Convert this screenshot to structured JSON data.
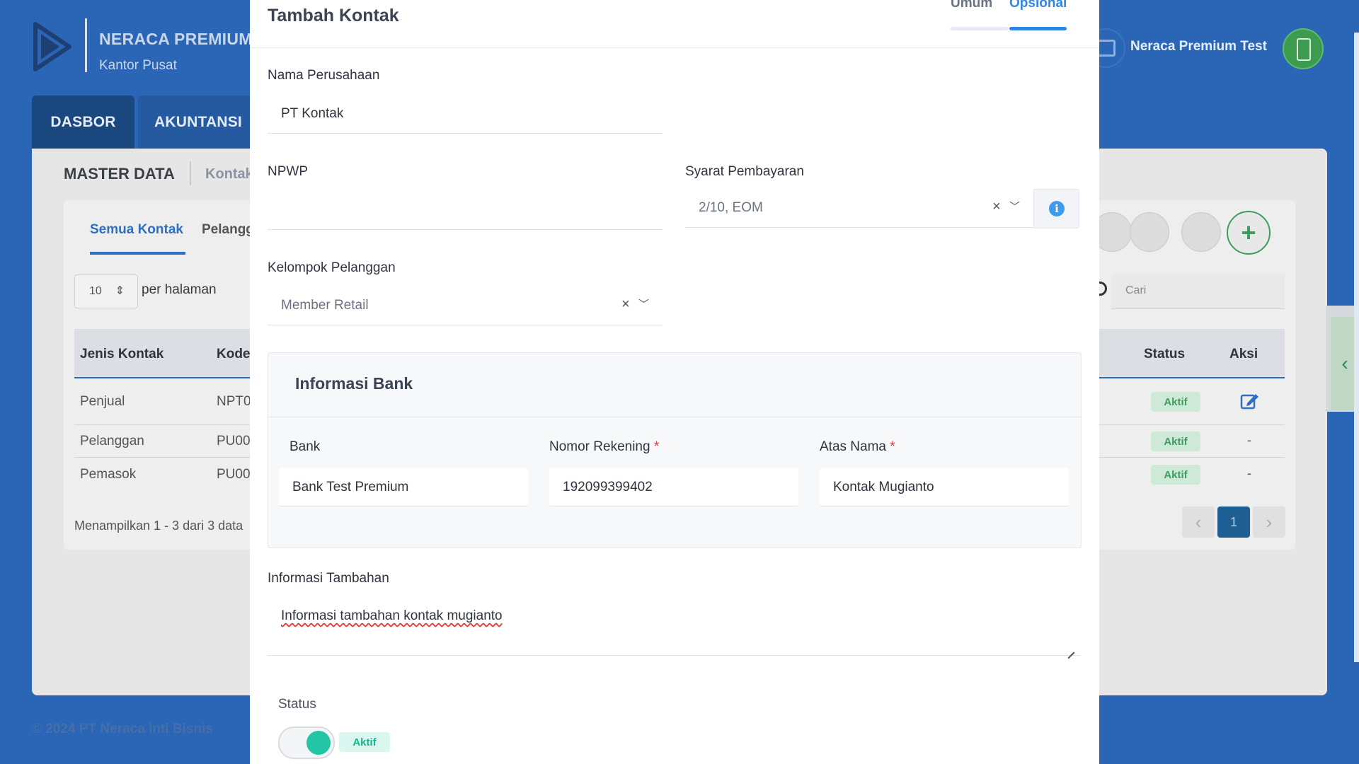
{
  "app": {
    "brand_name": "NERACA PREMIUM",
    "brand_sub": "Kantor Pusat",
    "user_name": "Neraca Premium Test",
    "nav": [
      "DASBOR",
      "AKUNTANSI"
    ],
    "copyright": "© 2024 PT Neraca Inti Bisnis"
  },
  "background_page": {
    "title": "MASTER DATA",
    "crumb": "Kontak",
    "tabs": [
      "Semua Kontak",
      "Pelanggan"
    ],
    "per_page_value": "10",
    "per_page_label": "per halaman",
    "search_placeholder": "Cari",
    "columns": [
      "Jenis Kontak",
      "Kode",
      "Status",
      "Aksi"
    ],
    "rows": [
      {
        "jenis": "Penjual",
        "kode": "NPT0",
        "status": "Aktif",
        "aksi": "edit"
      },
      {
        "jenis": "Pelanggan",
        "kode": "PU00",
        "status": "Aktif",
        "aksi": "-"
      },
      {
        "jenis": "Pemasok",
        "kode": "PU00",
        "status": "Aktif",
        "aksi": "-"
      }
    ],
    "showing": "Menampilkan 1 - 3 dari 3 data",
    "current_page": "1",
    "colors": {
      "header_bg": "#2a66b5",
      "accent_green": "#3c9d5e"
    }
  },
  "modal": {
    "title": "Tambah Kontak",
    "tabs": {
      "umum": "Umum",
      "opsional": "Opsional",
      "active": "Opsional"
    },
    "nama_perusahaan": {
      "label": "Nama Perusahaan",
      "value": "PT Kontak"
    },
    "npwp": {
      "label": "NPWP",
      "value": ""
    },
    "syarat_pembayaran": {
      "label": "Syarat Pembayaran",
      "value": "2/10, EOM"
    },
    "kelompok_pelanggan": {
      "label": "Kelompok Pelanggan",
      "value": "Member Retail"
    },
    "bank_section": {
      "title": "Informasi Bank",
      "bank": {
        "label": "Bank",
        "value": "Bank Test Premium"
      },
      "nomor_rekening": {
        "label": "Nomor Rekening",
        "required": "*",
        "value": "192099399402"
      },
      "atas_nama": {
        "label": "Atas Nama",
        "required": "*",
        "value": "Kontak Mugianto"
      }
    },
    "informasi_tambahan": {
      "label": "Informasi Tambahan",
      "value": "Informasi tambahan kontak mugianto"
    },
    "status": {
      "label": "Status",
      "toggle_on": true,
      "badge": "Aktif"
    },
    "colors": {
      "accent_blue": "#2f87e0",
      "toggle_teal": "#23c5a4",
      "required_red": "#e23b3b"
    }
  }
}
